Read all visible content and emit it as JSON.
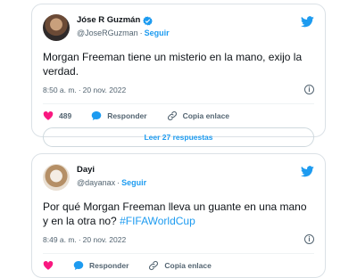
{
  "tweets": [
    {
      "author_name": "Jóse R Guzmán",
      "handle": "@JoseRGuzman",
      "follow_label": "Seguir",
      "text": "Morgan Freeman tiene un misterio en la mano, exijo la verdad.",
      "time": "8:50 a. m.",
      "date": "20 nov. 2022",
      "likes": "489",
      "reply_label": "Responder",
      "copy_label": "Copia enlace",
      "read_replies_label": "Leer 27 respuestas"
    },
    {
      "author_name": "Dayi",
      "handle": "@dayanax",
      "follow_label": "Seguir",
      "text": "Por qué Morgan Freeman lleva un guante en una mano y en la otra no?",
      "hashtag": "#FIFAWorldCup",
      "time": "8:49 a. m.",
      "date": "20 nov. 2022",
      "reply_label": "Responder",
      "copy_label": "Copia enlace"
    }
  ],
  "separator": "·",
  "colors": {
    "accent": "#1d9bf0",
    "like": "#f91880",
    "muted": "#536471"
  },
  "icons": [
    "verified-badge-icon",
    "twitter-bird-icon",
    "info-icon",
    "heart-icon",
    "reply-icon",
    "link-icon"
  ]
}
